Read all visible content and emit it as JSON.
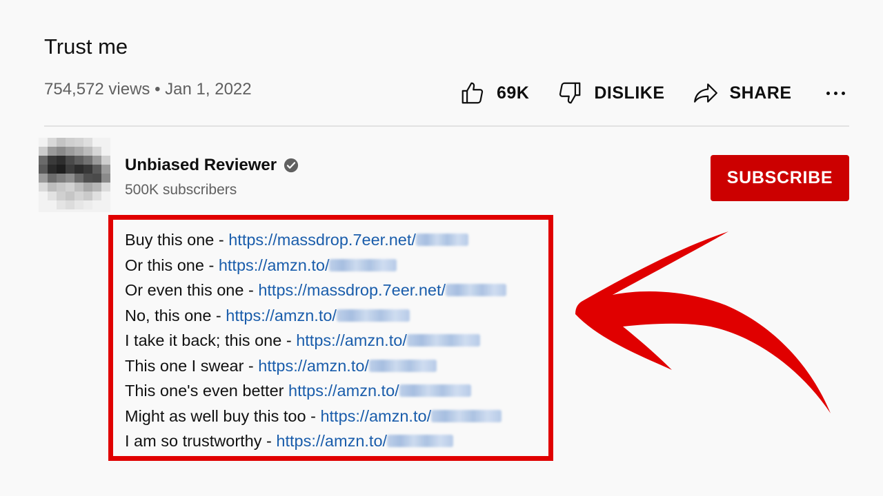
{
  "video": {
    "title": "Trust me",
    "meta": "754,572 views • Jan 1, 2022"
  },
  "actions": {
    "like_count": "69K",
    "dislike_label": "DISLIKE",
    "share_label": "SHARE"
  },
  "channel": {
    "name": "Unbiased Reviewer",
    "subscribers": "500K subscribers",
    "subscribe_label": "SUBSCRIBE"
  },
  "description": {
    "lines": [
      {
        "text": "Buy this one - ",
        "link": "https://massdrop.7eer.net/"
      },
      {
        "text": "Or this one - ",
        "link": "https://amzn.to/"
      },
      {
        "text": "Or even this one - ",
        "link": "https://massdrop.7eer.net/"
      },
      {
        "text": "No, this one - ",
        "link": "https://amzn.to/"
      },
      {
        "text": "I take it back; this one - ",
        "link": "https://amzn.to/"
      },
      {
        "text": "This one I swear - ",
        "link": "https://amzn.to/"
      },
      {
        "text": "This one's even better ",
        "link": "https://amzn.to/"
      },
      {
        "text": "Might as well buy this too - ",
        "link": "https://amzn.to/"
      },
      {
        "text": "I am so trustworthy - ",
        "link": "https://amzn.to/"
      }
    ]
  },
  "colors": {
    "subscribe_bg": "#cc0000",
    "highlight_border": "#e00000",
    "link": "#1a5dab"
  }
}
